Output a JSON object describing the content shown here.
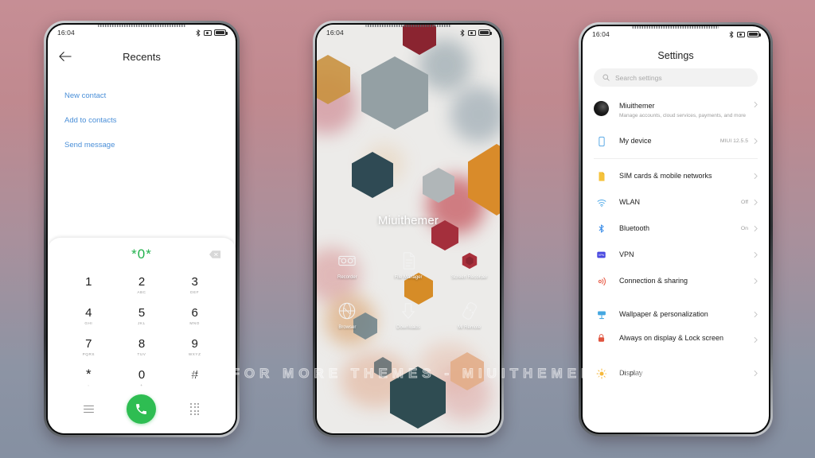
{
  "background": {
    "top_color": "#c68e95",
    "bottom_color": "#8590a2"
  },
  "watermark": {
    "text": "VISIT FOR MORE THEMES - MIUITHEMER.COM"
  },
  "status_bar": {
    "time": "16:04",
    "icons": [
      "bluetooth-icon",
      "camera-icon",
      "battery-icon"
    ]
  },
  "phone_left": {
    "title": "Recents",
    "back_icon": "back-arrow-icon",
    "actions": [
      {
        "label": "New contact"
      },
      {
        "label": "Add to contacts"
      },
      {
        "label": "Send message"
      }
    ],
    "dialpad": {
      "entered_number": "*0*",
      "accent_color": "#22b14c",
      "backspace_icon": "backspace-icon",
      "keys": [
        {
          "digit": "1",
          "sub": ""
        },
        {
          "digit": "2",
          "sub": "ABC"
        },
        {
          "digit": "3",
          "sub": "DEF"
        },
        {
          "digit": "4",
          "sub": "GHI"
        },
        {
          "digit": "5",
          "sub": "JKL"
        },
        {
          "digit": "6",
          "sub": "MNO"
        },
        {
          "digit": "7",
          "sub": "PQRS"
        },
        {
          "digit": "8",
          "sub": "TUV"
        },
        {
          "digit": "9",
          "sub": "WXYZ"
        },
        {
          "digit": "*",
          "sub": ","
        },
        {
          "digit": "0",
          "sub": "+"
        },
        {
          "digit": "#",
          "sub": ""
        }
      ],
      "bottom": {
        "menu_icon": "menu-icon",
        "call_icon": "call-icon",
        "keypad_icon": "keypad-icon",
        "call_color": "#2ebd52"
      }
    }
  },
  "phone_mid": {
    "home_title": "Miuithemer",
    "apps": [
      {
        "label": "Recorder",
        "icon": "recorder-icon"
      },
      {
        "label": "File Manager",
        "icon": "file-manager-icon"
      },
      {
        "label": "Screen Recorder",
        "icon": "screen-recorder-icon"
      },
      {
        "label": "Browser",
        "icon": "browser-icon"
      },
      {
        "label": "Downloads",
        "icon": "downloads-icon"
      },
      {
        "label": "Mi Remote",
        "icon": "mi-remote-icon"
      }
    ],
    "wallpaper_colors": [
      "#8a2430",
      "#4c6068",
      "#c98a3a",
      "#c7ccce",
      "#2f4a52",
      "#e0a98a"
    ]
  },
  "phone_right": {
    "title": "Settings",
    "search": {
      "placeholder": "Search settings",
      "icon": "search-icon"
    },
    "account": {
      "name": "Miuithemer",
      "subtitle": "Manage accounts, cloud services, payments, and more",
      "icon": "avatar"
    },
    "items": [
      {
        "label": "My device",
        "value": "MIUI 12.5.5",
        "icon": "device-icon",
        "color": "#5aa9e6"
      },
      {
        "label": "SIM cards & mobile networks",
        "value": "",
        "icon": "sim-icon",
        "color": "#f5c23b"
      },
      {
        "label": "WLAN",
        "value": "Off",
        "icon": "wifi-icon",
        "color": "#4fa9e8"
      },
      {
        "label": "Bluetooth",
        "value": "On",
        "icon": "bluetooth-icon",
        "color": "#3d8ee8"
      },
      {
        "label": "VPN",
        "value": "",
        "icon": "vpn-icon",
        "color": "#4a4ae0"
      },
      {
        "label": "Connection & sharing",
        "value": "",
        "icon": "connection-icon",
        "color": "#e8604c"
      },
      {
        "label": "Wallpaper & personalization",
        "value": "",
        "icon": "wallpaper-icon",
        "color": "#45a7e0"
      },
      {
        "label": "Always on display & Lock screen",
        "value": "",
        "icon": "lock-icon",
        "color": "#e0543f"
      },
      {
        "label": "Display",
        "value": "",
        "icon": "display-icon",
        "color": "#f6b93b"
      }
    ],
    "chevron_icon": "chevron-right-icon"
  }
}
